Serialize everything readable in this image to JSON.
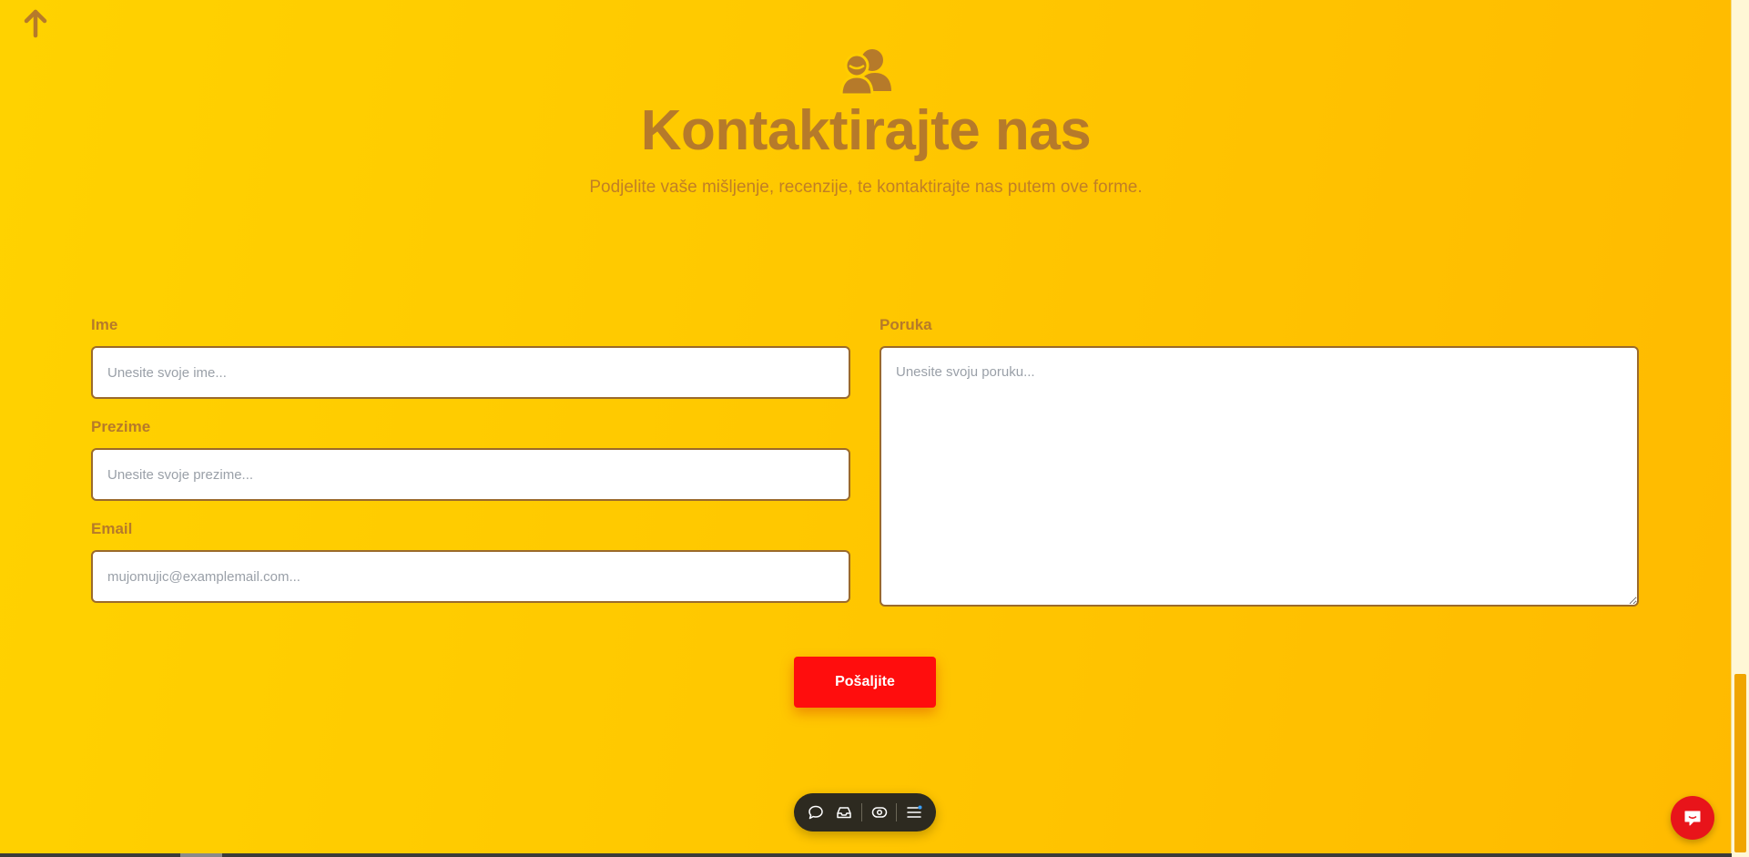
{
  "header": {
    "title": "Kontaktirajte nas",
    "subtitle": "Podjelite vaše mišljenje, recenzije, te kontaktirajte nas putem ove forme.",
    "icon": "users-icon"
  },
  "form": {
    "first_name": {
      "label": "Ime",
      "placeholder": "Unesite svoje ime...",
      "value": ""
    },
    "last_name": {
      "label": "Prezime",
      "placeholder": "Unesite svoje prezime...",
      "value": ""
    },
    "email": {
      "label": "Email",
      "placeholder": "mujomujic@examplemail.com...",
      "value": ""
    },
    "message": {
      "label": "Poruka",
      "placeholder": "Unesite svoju poruku...",
      "value": ""
    },
    "submit_label": "Pošaljite"
  },
  "toolbar": {
    "items": [
      "comment-icon",
      "inbox-icon",
      "eye-icon",
      "menu-icon"
    ]
  },
  "colors": {
    "accent_brown": "#b67a2a",
    "submit_red": "#ff0d0d",
    "background_yellow": "#ffc800"
  }
}
